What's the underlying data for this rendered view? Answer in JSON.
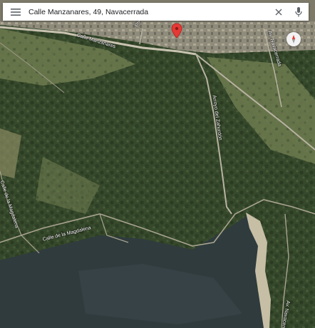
{
  "search": {
    "query": "Calle Manzanares, 49, Navacerrada",
    "menu_icon": "hamburger-menu-icon",
    "close_icon": "close-icon",
    "mic_icon": "microphone-icon"
  },
  "map": {
    "view": "satellite",
    "marker_icon": "location-pin-icon",
    "marker_color": "#e53935",
    "compass_icon": "compass-icon",
    "road_labels": {
      "calle_manzanares": "Calle Manzanares",
      "calle_de_la_magdalena": "Calle de la Magdalena",
      "calle_magdalena_vertical": "Calle de la Magdalena",
      "arroyo_zahurdon": "Arroyo del Zahurdón",
      "av_navacerrada_top": "Av. Navacerrada",
      "av_navacerrada_bottom": "Av. Navacerrada",
      "pso_label": "Pso. ..."
    }
  },
  "colors": {
    "forest": "#34482a",
    "meadow": "#6b7a4c",
    "water": "#2e3a3c",
    "road": "#b9b3a3",
    "shore": "#c9c0a8"
  }
}
